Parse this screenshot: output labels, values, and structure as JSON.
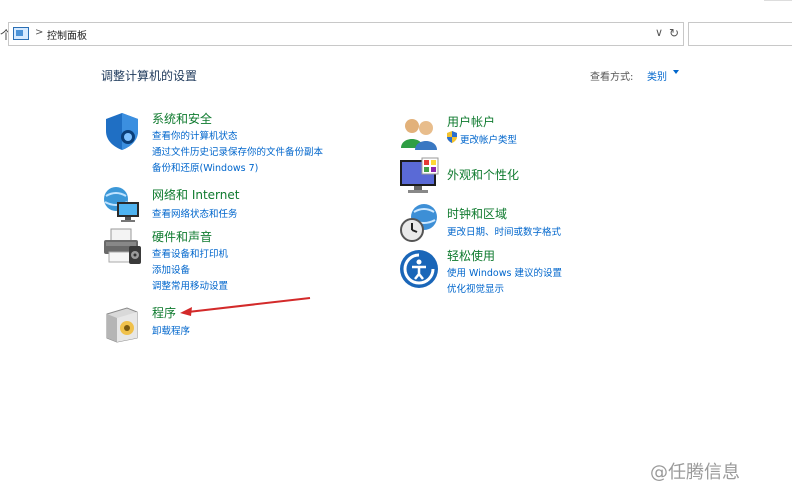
{
  "address_bar": {
    "up_glyph": "个",
    "separator": ">",
    "path": "控制面板",
    "dropdown_glyph": "∨",
    "refresh_glyph": "↻"
  },
  "header": {
    "title": "调整计算机的设置",
    "view_by_label": "查看方式:",
    "view_by_value": "类别"
  },
  "categories": [
    {
      "title": "系统和安全",
      "icon": "shield-icon",
      "links": [
        "查看你的计算机状态",
        "通过文件历史记录保存你的文件备份副本",
        "备份和还原(Windows 7)"
      ]
    },
    {
      "title": "网络和 Internet",
      "icon": "network-globe-icon",
      "links": [
        "查看网络状态和任务"
      ]
    },
    {
      "title": "硬件和声音",
      "icon": "printer-icon",
      "links": [
        "查看设备和打印机",
        "添加设备",
        "调整常用移动设置"
      ]
    },
    {
      "title": "程序",
      "icon": "programs-icon",
      "links": [
        "卸载程序"
      ]
    },
    {
      "title": "用户帐户",
      "icon": "users-icon",
      "links": [
        "更改帐户类型"
      ]
    },
    {
      "title": "外观和个性化",
      "icon": "monitor-palette-icon",
      "links": []
    },
    {
      "title": "时钟和区域",
      "icon": "clock-globe-icon",
      "links": [
        "更改日期、时间或数字格式"
      ]
    },
    {
      "title": "轻松使用",
      "icon": "ease-of-access-icon",
      "links": [
        "使用 Windows 建议的设置",
        "优化视觉显示"
      ]
    }
  ],
  "annotation": {
    "arrow_color": "#d32a2a"
  },
  "watermark": "@任腾信息",
  "colors": {
    "category_title": "#0e7a2e",
    "link": "#0066cc",
    "title": "#1e395b"
  }
}
